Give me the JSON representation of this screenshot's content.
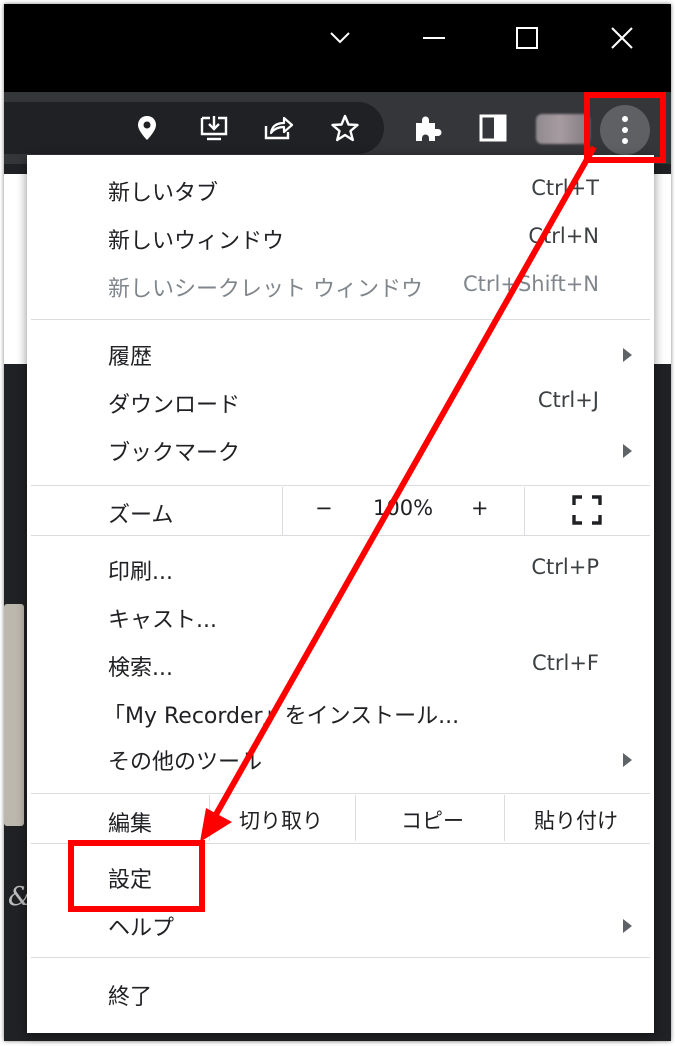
{
  "window": {
    "controls": [
      {
        "name": "tab-search-icon"
      },
      {
        "name": "minimize-icon"
      },
      {
        "name": "maximize-icon"
      },
      {
        "name": "close-icon"
      }
    ]
  },
  "toolbar": {
    "icons": [
      "location-pin-icon",
      "install-app-icon",
      "share-icon",
      "bookmark-star-icon",
      "extensions-icon",
      "side-panel-icon",
      "profile-avatar",
      "menu-kebab-icon"
    ]
  },
  "menu": {
    "new_tab": {
      "label": "新しいタブ",
      "shortcut": "Ctrl+T"
    },
    "new_window": {
      "label": "新しいウィンドウ",
      "shortcut": "Ctrl+N"
    },
    "new_incognito": {
      "label": "新しいシークレット ウィンドウ",
      "shortcut": "Ctrl+Shift+N"
    },
    "history": {
      "label": "履歴"
    },
    "downloads": {
      "label": "ダウンロード",
      "shortcut": "Ctrl+J"
    },
    "bookmarks": {
      "label": "ブックマーク"
    },
    "zoom": {
      "label": "ズーム",
      "minus": "−",
      "value": "100%",
      "plus": "+"
    },
    "print": {
      "label": "印刷...",
      "shortcut": "Ctrl+P"
    },
    "cast": {
      "label": "キャスト..."
    },
    "find": {
      "label": "検索...",
      "shortcut": "Ctrl+F"
    },
    "install": {
      "label": "「My Recorder」をインストール..."
    },
    "more_tools": {
      "label": "その他のツール"
    },
    "edit": {
      "label": "編集",
      "cut": "切り取り",
      "copy": "コピー",
      "paste": "貼り付け"
    },
    "settings": {
      "label": "設定"
    },
    "help": {
      "label": "ヘルプ"
    },
    "exit": {
      "label": "終了"
    }
  },
  "page": {
    "glyph": "&"
  },
  "annotation": {
    "color": "#ff0000"
  }
}
